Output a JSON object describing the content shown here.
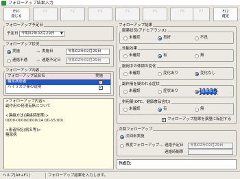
{
  "window": {
    "title": "フォローアップ結果入力"
  },
  "toolbar": {
    "keys": [
      {
        "top": "ESC",
        "bottom": "閉じる",
        "enabled": true
      },
      {
        "top": "F1",
        "bottom": "",
        "enabled": false
      },
      {
        "top": "F2",
        "bottom": "",
        "enabled": false
      },
      {
        "top": "F3",
        "bottom": "",
        "enabled": false
      },
      {
        "top": "F4",
        "bottom": "",
        "enabled": false
      },
      {
        "top": "F5",
        "bottom": "",
        "enabled": false
      },
      {
        "top": "F6",
        "bottom": "",
        "enabled": false
      },
      {
        "top": "F7",
        "bottom": "",
        "enabled": false
      },
      {
        "top": "F12",
        "bottom": "確定",
        "enabled": true
      }
    ]
  },
  "planned_date": {
    "group": "フォローアップ予定日",
    "label": "予定日",
    "value": "令和02年02月29日"
  },
  "status": {
    "group": "フォローアップ状況",
    "row1": {
      "option": "実施",
      "arrow": "→",
      "label": "実施日",
      "value": "令和02年02月29日",
      "selected": true
    },
    "row2": {
      "option": "連絡不通",
      "arrow": "→",
      "label": "連絡予定日",
      "value": "令和02年02月29日",
      "selected": false
    }
  },
  "plan_list": {
    "group": "フォローアップ内容",
    "col_name": "フォローアップ品名名",
    "col_done": "実施",
    "rows": [
      {
        "name": "糖尿病患者",
        "checked": true,
        "selected": true
      },
      {
        "name": "ハイリスク薬の説明",
        "checked": true,
        "selected": false
      }
    ]
  },
  "memo": {
    "lines": [
      "<フォローアップ内容>",
      "副作用の発現有無について",
      "",
      "<連絡方法(連絡時間帯)>",
      "0000-0000(0000(14:00-15:00)",
      "",
      "<患者特記(病名等)>",
      "糖尿病"
    ]
  },
  "results": {
    "group": "フォローアップ結果",
    "sections": [
      {
        "title": "服薬状況(アドヒアランス)",
        "options": [
          "未確認",
          "良好",
          "不良"
        ],
        "selected": 1
      },
      {
        "title": "効能効果",
        "options": [
          "未確認",
          "有",
          "無"
        ],
        "selected": 1
      },
      {
        "title": "服用中の体調の変化",
        "options": [
          "未確認",
          "変化あり",
          "変化なし"
        ],
        "selected": 2
      },
      {
        "title": "副作用を疑われる症状",
        "options": [
          "未確認",
          "症状あり",
          "症状なし"
        ],
        "selected": 2
      },
      {
        "title": "併用薬(OTC、健康食品含む)",
        "options": [
          "未確認",
          "有",
          "無"
        ],
        "selected": 1
      }
    ],
    "reprint": {
      "label": "フォローアップ結果を薬歴に転記する",
      "checked": true
    }
  },
  "next": {
    "group": "次回フォローアップ",
    "opt1": {
      "label": "次回未実施",
      "selected": true
    },
    "opt2": {
      "label": "再度フォローアップ",
      "arrow": "→",
      "date_label": "連絡予定日",
      "date_value": "令和02年02月29日",
      "selected": false
    },
    "time_label": "連絡時間帯"
  },
  "creator": {
    "label": "作成日:"
  },
  "statusbar": {
    "help": "ヘルプ[Alt+F1]",
    "message": "フォローアップ結果を入力します。"
  }
}
